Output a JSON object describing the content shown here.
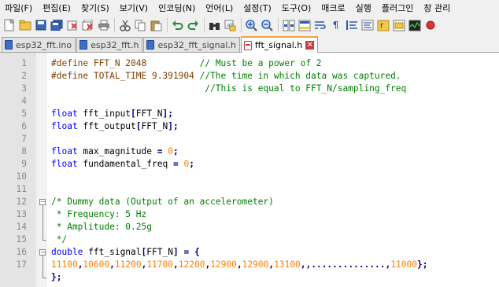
{
  "menu": [
    "파일(F)",
    "편집(E)",
    "찾기(S)",
    "보기(V)",
    "인코딩(N)",
    "언어(L)",
    "설정(T)",
    "도구(O)",
    "매크로",
    "실행",
    "플러그인",
    "창 관리"
  ],
  "tabs": [
    {
      "label": "esp32_fft.ino",
      "active": false
    },
    {
      "label": "esp32_fft.h",
      "active": false
    },
    {
      "label": "esp32_fft_signal.h",
      "active": false
    },
    {
      "label": "fft_signal.h",
      "active": true
    }
  ],
  "tab_close_glyph": "×",
  "toolbar_icons": [
    "new-file-icon",
    "open-file-icon",
    "save-icon",
    "save-all-icon",
    "close-icon",
    "close-all-icon",
    "print-icon",
    "cut-icon",
    "copy-icon",
    "paste-icon",
    "undo-icon",
    "redo-icon",
    "find-icon",
    "replace-icon",
    "zoom-in-icon",
    "zoom-out-icon",
    "sync-vertical-icon",
    "sync-horizontal-icon",
    "word-wrap-icon",
    "show-all-chars-icon",
    "indent-guide-icon",
    "language-icon",
    "function-list-icon",
    "folder-workspace-icon",
    "monitoring-icon",
    "record-macro-icon"
  ],
  "editor": {
    "lines": [
      {
        "n": "1",
        "tokens": [
          [
            "pp",
            "#define FFT_N 2048"
          ],
          [
            "plain",
            "          "
          ],
          [
            "cm",
            "// Must be a power of 2"
          ]
        ]
      },
      {
        "n": "2",
        "tokens": [
          [
            "pp",
            "#define TOTAL_TIME 9.391904 "
          ],
          [
            "cm",
            "//The time in which data was captured."
          ]
        ]
      },
      {
        "n": "3",
        "tokens": [
          [
            "plain",
            "                             "
          ],
          [
            "cm",
            "//This is equal to FFT_N/sampling_freq"
          ]
        ]
      },
      {
        "n": "4",
        "tokens": []
      },
      {
        "n": "5",
        "tokens": [
          [
            "kw",
            "float"
          ],
          [
            "plain",
            " fft_input"
          ],
          [
            "op",
            "["
          ],
          [
            "plain",
            "FFT_N"
          ],
          [
            "op",
            "];"
          ]
        ]
      },
      {
        "n": "6",
        "tokens": [
          [
            "kw",
            "float"
          ],
          [
            "plain",
            " fft_output"
          ],
          [
            "op",
            "["
          ],
          [
            "plain",
            "FFT_N"
          ],
          [
            "op",
            "];"
          ]
        ]
      },
      {
        "n": "7",
        "tokens": []
      },
      {
        "n": "8",
        "tokens": [
          [
            "kw",
            "float"
          ],
          [
            "plain",
            " max_magnitude "
          ],
          [
            "op",
            "="
          ],
          [
            "plain",
            " "
          ],
          [
            "nm",
            "0"
          ],
          [
            "op",
            ";"
          ]
        ]
      },
      {
        "n": "9",
        "tokens": [
          [
            "kw",
            "float"
          ],
          [
            "plain",
            " fundamental_freq "
          ],
          [
            "op",
            "="
          ],
          [
            "plain",
            " "
          ],
          [
            "nm",
            "0"
          ],
          [
            "op",
            ";"
          ]
        ]
      },
      {
        "n": "10",
        "tokens": []
      },
      {
        "n": "11",
        "tokens": []
      },
      {
        "n": "12",
        "tokens": [
          [
            "cm",
            "/* Dummy data (Output of an accelerometer)"
          ]
        ]
      },
      {
        "n": "13",
        "tokens": [
          [
            "cm",
            " * Frequency: 5 Hz"
          ]
        ]
      },
      {
        "n": "14",
        "tokens": [
          [
            "cm",
            " * Amplitude: 0.25g"
          ]
        ]
      },
      {
        "n": "15",
        "tokens": [
          [
            "cm",
            " */"
          ]
        ]
      },
      {
        "n": "16",
        "tokens": [
          [
            "kw",
            "double"
          ],
          [
            "plain",
            " fft_signal"
          ],
          [
            "op",
            "["
          ],
          [
            "plain",
            "FFT_N"
          ],
          [
            "op",
            "]"
          ],
          [
            "plain",
            " "
          ],
          [
            "op",
            "="
          ],
          [
            "plain",
            " "
          ],
          [
            "op",
            "{"
          ]
        ]
      },
      {
        "n": "17",
        "tokens": [
          [
            "nm",
            "11100"
          ],
          [
            "op",
            ","
          ],
          [
            "nm",
            "10600"
          ],
          [
            "op",
            ","
          ],
          [
            "nm",
            "11200"
          ],
          [
            "op",
            ","
          ],
          [
            "nm",
            "11700"
          ],
          [
            "op",
            ","
          ],
          [
            "nm",
            "12200"
          ],
          [
            "op",
            ","
          ],
          [
            "nm",
            "12900"
          ],
          [
            "op",
            ","
          ],
          [
            "nm",
            "12900"
          ],
          [
            "op",
            ","
          ],
          [
            "nm",
            "13100"
          ],
          [
            "op",
            ",,..............,"
          ],
          [
            "nm",
            "11000"
          ],
          [
            "op",
            "};"
          ]
        ]
      },
      {
        "n": "",
        "tokens": [
          [
            "op",
            "};"
          ]
        ]
      }
    ]
  }
}
